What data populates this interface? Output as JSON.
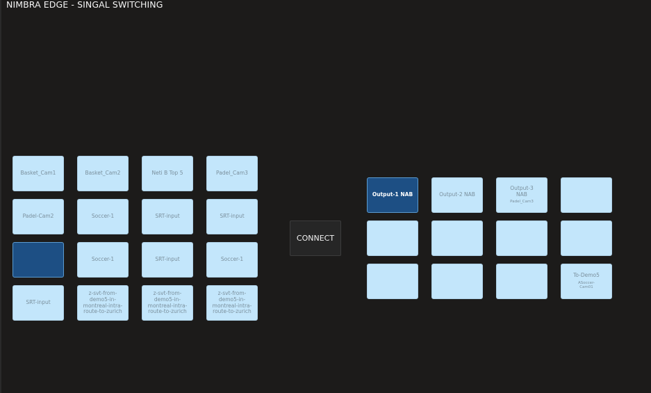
{
  "title": "NIMBRA EDGE - SINGAL SWITCHING",
  "connect_label": "CONNECT",
  "sources": [
    {
      "label": "Basket_Cam1"
    },
    {
      "label": "Basket_Cam2"
    },
    {
      "label": "Neti B Top 5"
    },
    {
      "label": "Padel_Cam3"
    },
    {
      "label": "Padel-Cam2"
    },
    {
      "label": "Soccer-1"
    },
    {
      "label": "SRT-input"
    },
    {
      "label": "SRT-input"
    },
    {
      "label": ""
    },
    {
      "label": "Soccer-1"
    },
    {
      "label": "SRT-input"
    },
    {
      "label": "Soccer-1"
    },
    {
      "label": "SRT-input"
    },
    {
      "label": "z-svt-from-demo5-in-montreal-intra-route-to-zurich"
    },
    {
      "label": "z-svt-from-demo5-in-montreal-intra-route-to-zurich"
    },
    {
      "label": "z-svt-from-demo5-in-montreal-intra-route-to-zurich"
    }
  ],
  "outputs": [
    {
      "label": "Output-1 NAB",
      "sub": ""
    },
    {
      "label": "Output-2 NAB",
      "sub": ""
    },
    {
      "label": "Output-3\nNAB",
      "sub": "Padel_Cam3"
    },
    {
      "label": "",
      "sub": ""
    },
    {
      "label": "",
      "sub": ""
    },
    {
      "label": "",
      "sub": ""
    },
    {
      "label": "",
      "sub": ""
    },
    {
      "label": "",
      "sub": ""
    },
    {
      "label": "",
      "sub": ""
    },
    {
      "label": "",
      "sub": ""
    },
    {
      "label": "",
      "sub": ""
    },
    {
      "label": "To-Demo5",
      "sub": "ASoccer-\nCam01"
    }
  ],
  "colors": {
    "background": "#1c1b1a",
    "tile": "#c3e6fb",
    "tile_selected": "#1d4f84",
    "tile_text": "#7a8f9c",
    "connect_bg": "#262626"
  }
}
